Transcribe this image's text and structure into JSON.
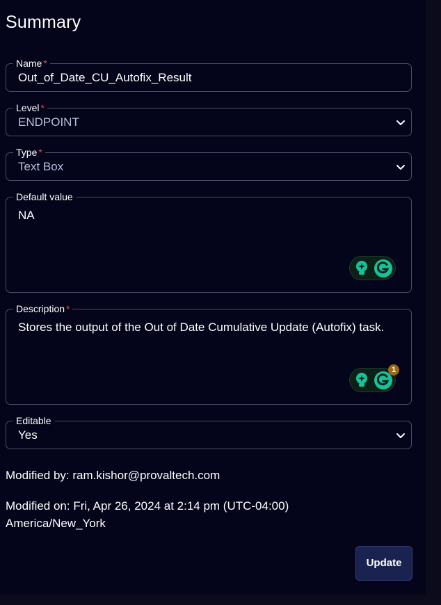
{
  "summary": {
    "title": "Summary"
  },
  "fields": {
    "name": {
      "label": "Name",
      "required_mark": "*",
      "value": "Out_of_Date_CU_Autofix_Result"
    },
    "level": {
      "label": "Level",
      "required_mark": "*",
      "value": "ENDPOINT",
      "icon": "chevron-down-icon"
    },
    "type": {
      "label": "Type",
      "required_mark": "*",
      "value": "Text Box",
      "icon": "chevron-down-icon"
    },
    "default_value": {
      "label": "Default value",
      "value": "NA"
    },
    "description": {
      "label": "Description",
      "required_mark": "*",
      "value": "Stores the output of the Out of Date Cumulative Update (Autofix) task."
    },
    "editable": {
      "label": "Editable",
      "value": "Yes",
      "icon": "chevron-down-icon"
    }
  },
  "grammarly": {
    "badge_count": "1",
    "icons": [
      "bulb-icon",
      "grammarly-icon"
    ]
  },
  "meta": {
    "modified_by": "Modified by: ram.kishor@provaltech.com",
    "modified_on_line1": "Modified on: Fri, Apr 26, 2024 at 2:14 pm (UTC-04:00)",
    "modified_on_line2": "America/New_York"
  },
  "actions": {
    "update_label": "Update"
  },
  "colors": {
    "background": "#04041a",
    "border": "#4a4f6e",
    "required": "#e5484d",
    "button": "#1a2250",
    "grammarly_green": "#15c39a"
  }
}
